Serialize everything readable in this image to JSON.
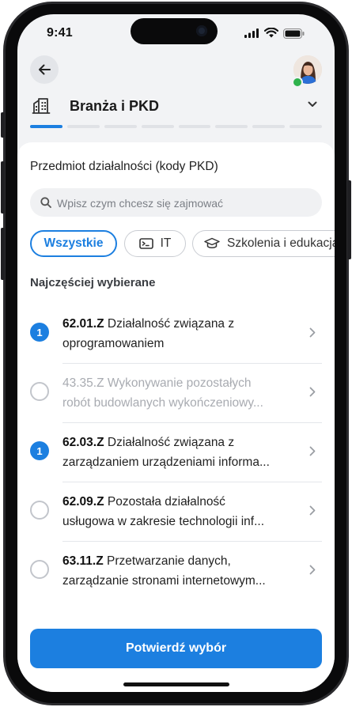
{
  "status_bar": {
    "time": "9:41"
  },
  "header": {
    "section_title": "Branża i PKD",
    "steps_total": 8,
    "steps_active": 1
  },
  "card": {
    "title": "Przedmiot działalności (kody PKD)",
    "search": {
      "placeholder": "Wpisz czym chcesz się zajmować",
      "value": ""
    },
    "chips": [
      {
        "label": "Wszystkie",
        "active": true,
        "icon": ""
      },
      {
        "label": "IT",
        "active": false,
        "icon": "terminal-icon"
      },
      {
        "label": "Szkolenia i edukacja",
        "active": false,
        "icon": "graduation-cap-icon"
      }
    ],
    "subhead": "Najczęściej wybierane",
    "items": [
      {
        "code": "62.01.Z",
        "line1": "Działalność związana z",
        "line2": "oprogramowaniem",
        "selected": true,
        "badge": "1",
        "disabled": false
      },
      {
        "code": "43.35.Z",
        "line1": "Wykonywanie pozostałych",
        "line2": "robót budowlanych wykończeniowy...",
        "selected": false,
        "badge": "",
        "disabled": true
      },
      {
        "code": "62.03.Z",
        "line1": "Działalność związana z",
        "line2": "zarządzaniem urządzeniami informa...",
        "selected": true,
        "badge": "1",
        "disabled": false
      },
      {
        "code": "62.09.Z",
        "line1": "Pozostała działalność",
        "line2": "usługowa w zakresie technologii inf...",
        "selected": false,
        "badge": "",
        "disabled": false
      },
      {
        "code": "63.11.Z",
        "line1": "Przetwarzanie danych,",
        "line2": "zarządzanie stronami internetowym...",
        "selected": false,
        "badge": "",
        "disabled": false
      }
    ],
    "confirm_label": "Potwierdź wybór"
  },
  "colors": {
    "accent": "#1c7fe0",
    "online": "#2fb24c",
    "background": "#f2f3f5"
  }
}
